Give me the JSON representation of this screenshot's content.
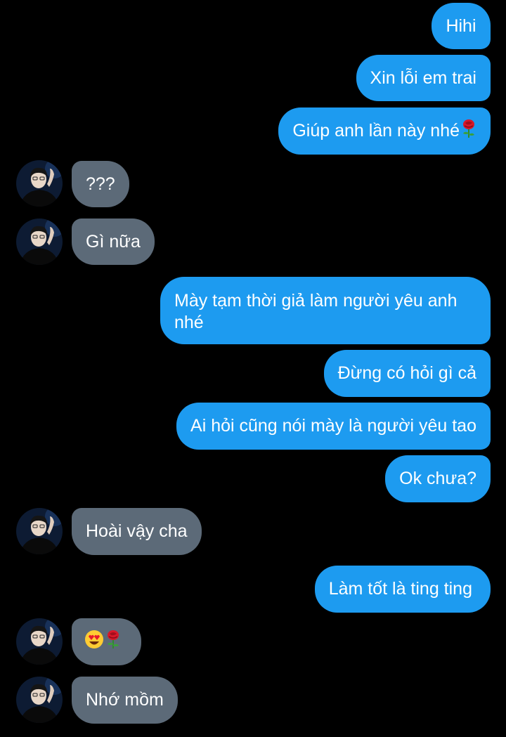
{
  "messages": [
    {
      "side": "out",
      "text": "Hihi"
    },
    {
      "side": "out",
      "text": "Xin lỗi em trai"
    },
    {
      "side": "out",
      "text": "Giúp anh lần này nhé",
      "icon": "rose-emoji"
    },
    {
      "side": "in",
      "text": "???"
    },
    {
      "side": "in",
      "text": "Gì nữa"
    },
    {
      "side": "out",
      "text": "Mày tạm thời giả làm người yêu anh nhé"
    },
    {
      "side": "out",
      "text": "Đừng có hỏi gì cả"
    },
    {
      "side": "out",
      "text": "Ai hỏi cũng nói mày là người yêu tao"
    },
    {
      "side": "out",
      "text": "Ok chưa?"
    },
    {
      "side": "in",
      "text": "Hoài vậy cha"
    },
    {
      "side": "out",
      "text": "Làm tốt là ting ting"
    },
    {
      "side": "in",
      "text": "",
      "icons": [
        "heart-eyes-emoji",
        "rose-emoji"
      ]
    },
    {
      "side": "in",
      "text": "Nhớ mồm"
    }
  ],
  "colors": {
    "outgoing_bubble": "#1d9bf0",
    "incoming_bubble": "#5c6a78",
    "background": "#000000",
    "text": "#ffffff"
  }
}
